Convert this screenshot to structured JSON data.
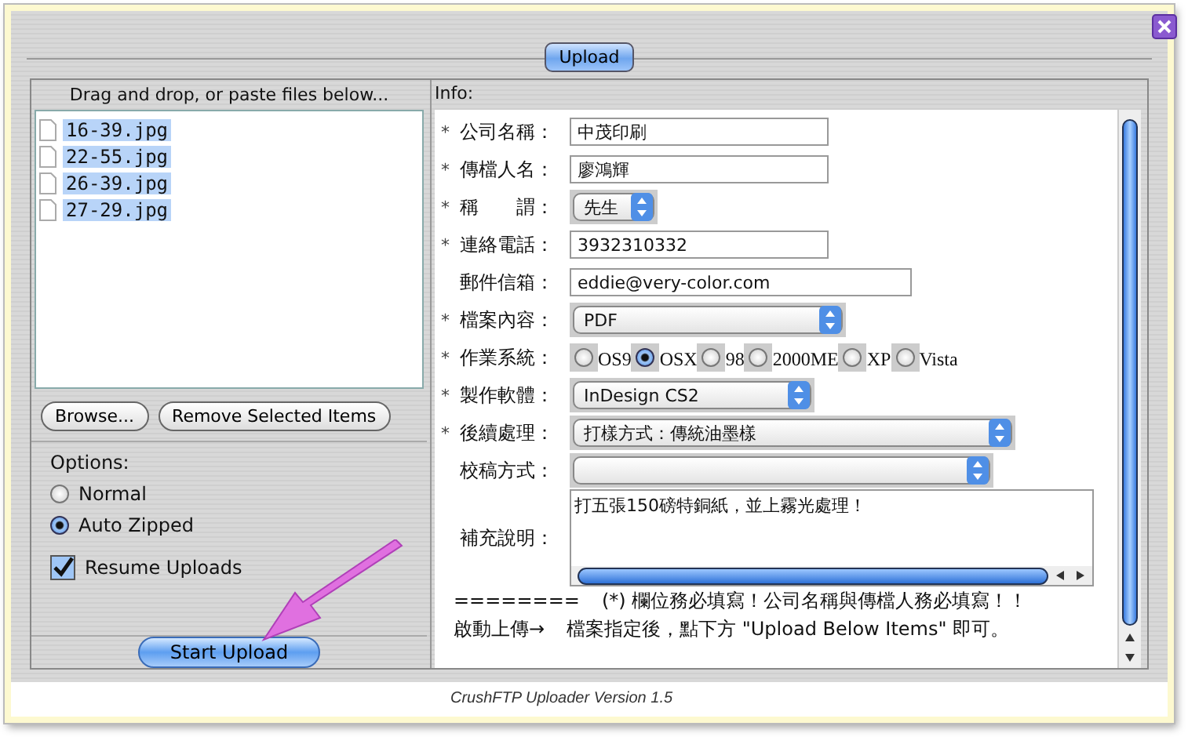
{
  "tab": {
    "label": "Upload",
    "selected": true
  },
  "files": {
    "heading": "Drag and drop, or paste files below...",
    "items": [
      {
        "name": "16-39.jpg",
        "selected": true
      },
      {
        "name": "22-55.jpg",
        "selected": true
      },
      {
        "name": "26-39.jpg",
        "selected": true
      },
      {
        "name": "27-29.jpg",
        "selected": true
      }
    ]
  },
  "file_buttons": [
    "Browse...",
    "Remove Selected Items"
  ],
  "options": {
    "heading": "Options:",
    "modes": [
      {
        "label": "Normal",
        "selected": false
      },
      {
        "label": "Auto Zipped",
        "selected": true
      }
    ],
    "resume": {
      "label": "Resume Uploads",
      "checked": true
    }
  },
  "start_button": "Start Upload",
  "info": {
    "heading": "Info:",
    "required_mark": "*",
    "fields": [
      {
        "kind": "text",
        "required": true,
        "label": "公司名稱：",
        "value": "中茂印刷"
      },
      {
        "kind": "text",
        "required": true,
        "label": "傳檔人名：",
        "value": "廖鴻輝"
      },
      {
        "kind": "select",
        "required": true,
        "label": "稱　　謂：",
        "value": "先生"
      },
      {
        "kind": "text",
        "required": true,
        "label": "連絡電話：",
        "value": "3932310332"
      },
      {
        "kind": "text",
        "required": false,
        "label": "郵件信箱：",
        "value": "eddie@very-color.com"
      },
      {
        "kind": "select",
        "required": true,
        "label": "檔案內容：",
        "value": "PDF"
      },
      {
        "kind": "radio",
        "required": true,
        "label": "作業系統：",
        "options": [
          {
            "label": "OS9",
            "selected": false
          },
          {
            "label": "OSX",
            "selected": true
          },
          {
            "label": "98",
            "selected": false
          },
          {
            "label": "2000ME",
            "selected": false
          },
          {
            "label": "XP",
            "selected": false
          },
          {
            "label": "Vista",
            "selected": false
          }
        ]
      },
      {
        "kind": "select",
        "required": true,
        "label": "製作軟體：",
        "value": "InDesign CS2"
      },
      {
        "kind": "select",
        "required": true,
        "label": "後續處理：",
        "value": "打樣方式：傳統油墨樣"
      },
      {
        "kind": "select",
        "required": false,
        "label": "校稿方式："
      },
      {
        "kind": "textarea",
        "required": false,
        "label": "補充說明：",
        "value": "打五張150磅特銅紙，並上霧光處理！"
      }
    ],
    "notes": [
      {
        "lead": "========",
        "text": "(*) 欄位務必填寫！公司名稱與傳檔人務必填寫！！"
      },
      {
        "lead": "啟動上傳→",
        "text": "檔案指定後，點下方 \"Upload Below Items\" 即可。"
      }
    ]
  },
  "footer": "CrushFTP Uploader Version 1.5"
}
